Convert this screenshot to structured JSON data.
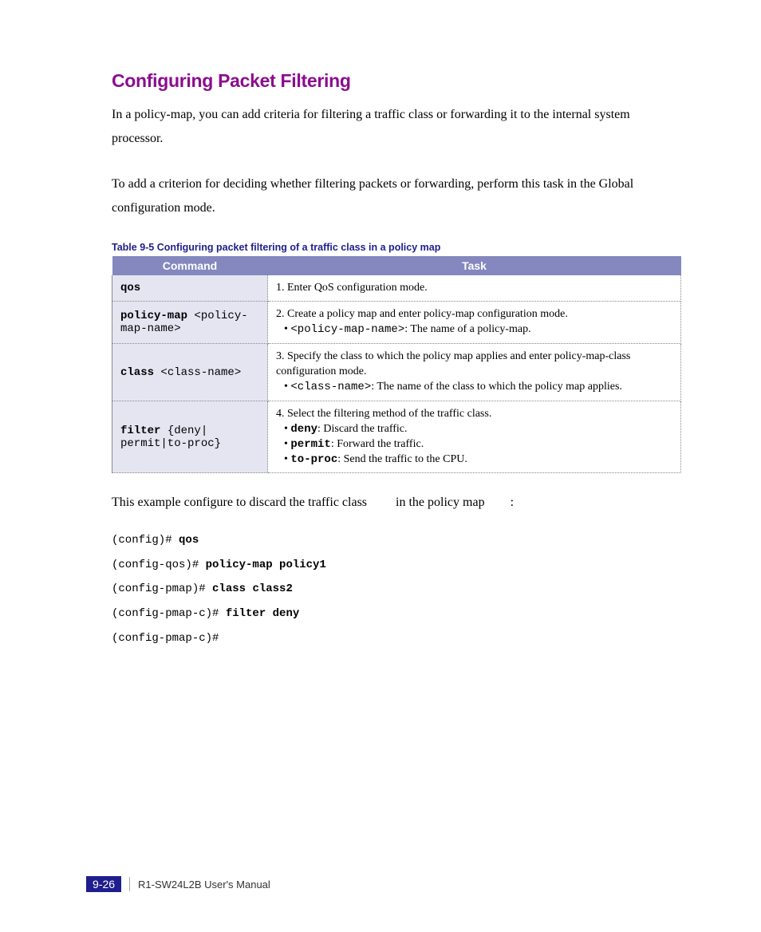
{
  "heading": "Configuring Packet Filtering",
  "para1": "In a policy-map, you can add criteria for filtering a traffic class or forwarding it to the internal system processor.",
  "para2": "To add a criterion for deciding whether filtering packets or forwarding, perform this task in the Global configuration mode.",
  "table_caption": "Table 9-5   Configuring packet filtering of a traffic class in a policy map",
  "table": {
    "headers": {
      "cmd": "Command",
      "task": "Task"
    },
    "rows": [
      {
        "cmd_bold": "qos",
        "cmd_arg": "",
        "task_num_pre": "1.",
        "task_text": "Enter QoS configuration mode.",
        "task_bullets": []
      },
      {
        "cmd_bold": "policy-map ",
        "cmd_arg": "<policy-map-name>",
        "task_num_pre": "2.",
        "task_text": "Create a policy map and enter policy-map configuration mode.",
        "task_bullets": [
          {
            "mono": "<policy-map-name>",
            "rest": ": The name of a policy-map."
          }
        ]
      },
      {
        "cmd_bold": "class ",
        "cmd_arg": "<class-name>",
        "task_num_pre": "3.",
        "task_text": "Specify the class to which the policy map applies and enter policy-map-class configuration mode.",
        "task_bullets": [
          {
            "mono": "<class-name>",
            "rest": ": The name of the class to which the policy map applies."
          }
        ]
      },
      {
        "cmd_bold": "filter",
        "cmd_arg": " {deny| permit|to-proc}",
        "task_num_pre": "4.",
        "task_text": "Select the filtering method of the traffic class.",
        "task_bullets": [
          {
            "mono": "deny",
            "rest": ": Discard the traffic."
          },
          {
            "mono": "permit",
            "rest": ": Forward the traffic."
          },
          {
            "mono": "to-proc",
            "rest": ": Send the traffic to the CPU."
          }
        ]
      }
    ]
  },
  "example_intro_a": "This example configure to discard the traffic class ",
  "example_intro_b": " in the policy map ",
  "example_intro_c": ":",
  "cli": [
    {
      "prompt": "(config)# ",
      "bold": "qos"
    },
    {
      "prompt": "(config-qos)# ",
      "bold": "policy-map policy1"
    },
    {
      "prompt": "(config-pmap)# ",
      "bold": "class class2"
    },
    {
      "prompt": "(config-pmap-c)# ",
      "bold": "filter deny"
    },
    {
      "prompt": "(config-pmap-c)#",
      "bold": ""
    }
  ],
  "footer": {
    "page": "9-26",
    "text": "R1-SW24L2B   User's Manual"
  }
}
